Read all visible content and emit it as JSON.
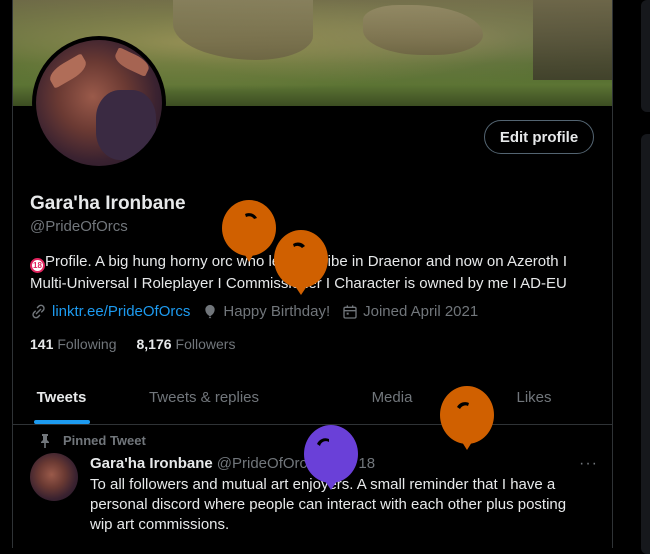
{
  "profile": {
    "name": "Gara'ha Ironbane",
    "handle": "@PrideOfOrcs",
    "edit_label": "Edit profile",
    "bio_badge": "18",
    "bio_text": "Profile. A big hung horny orc who led her tribe in Draenor and now on Azeroth I Multi-Universal I Roleplayer I Commissioner I Character is owned by me I AD-EU",
    "link": "linktr.ee/PrideOfOrcs",
    "birthday": "Happy Birthday!",
    "joined": "Joined April 2021",
    "following_count": "141",
    "following_label": "Following",
    "followers_count": "8,176",
    "followers_label": "Followers"
  },
  "tabs": [
    {
      "label": "Tweets"
    },
    {
      "label": "Tweets & replies"
    },
    {
      "label": "Media"
    },
    {
      "label": "Likes"
    }
  ],
  "pinned_tweet": {
    "pinned_label": "Pinned Tweet",
    "author": "Gara'ha Ironbane",
    "handle": "@PrideOfOrcs",
    "separator": "·",
    "date": "Nov 18",
    "more": "···",
    "text": "To all followers and mutual art enjoyers. A small reminder that I have a personal discord where people can interact with each other plus posting wip art commissions."
  },
  "colors": {
    "accent": "#1d9bf0",
    "balloon_orange": "#d06000",
    "balloon_purple": "#6a40d8"
  }
}
